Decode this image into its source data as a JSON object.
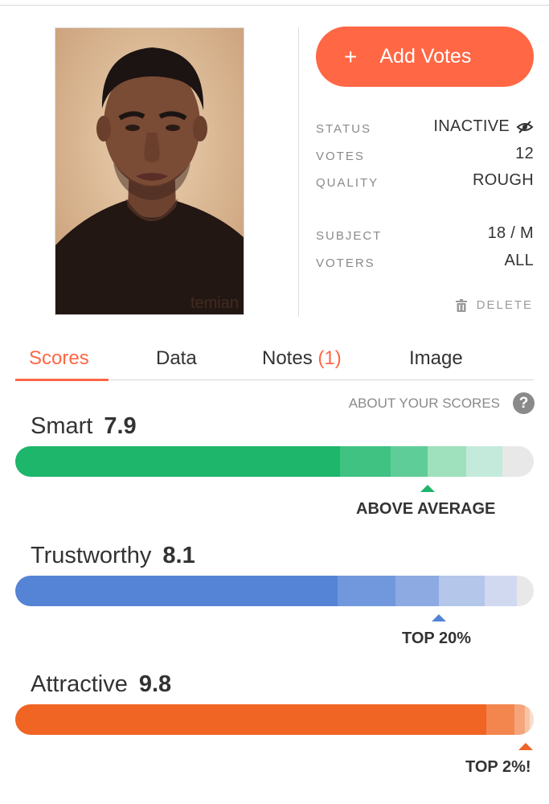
{
  "profile": {
    "watermark": "temian",
    "add_votes_label": "Add Votes",
    "add_votes_icon": "plus-icon",
    "meta": [
      {
        "label": "STATUS",
        "value": "INACTIVE",
        "icon": "eye-slash-icon"
      },
      {
        "label": "VOTES",
        "value": "12"
      },
      {
        "label": "QUALITY",
        "value": "ROUGH"
      },
      {
        "label": "SUBJECT",
        "value": "18 / M"
      },
      {
        "label": "VOTERS",
        "value": "ALL"
      }
    ],
    "delete_label": "DELETE"
  },
  "tabs": [
    {
      "label": "Scores",
      "active": true
    },
    {
      "label": "Data"
    },
    {
      "label": "Notes ",
      "count": "(1)"
    },
    {
      "label": "Image"
    }
  ],
  "about_label": "ABOUT YOUR SCORES",
  "scores": [
    {
      "name": "Smart",
      "value": "7.9",
      "percentile_label": "ABOVE AVERAGE",
      "color": "#1db66b",
      "fill_fraction": 0.79
    },
    {
      "name": "Trustworthy",
      "value": "8.1",
      "percentile_label": "TOP 20%",
      "color": "#5584d6",
      "fill_fraction": 0.81
    },
    {
      "name": "Attractive",
      "value": "9.8",
      "percentile_label": "TOP 2%!",
      "color": "#f06424",
      "fill_fraction": 0.98
    }
  ]
}
